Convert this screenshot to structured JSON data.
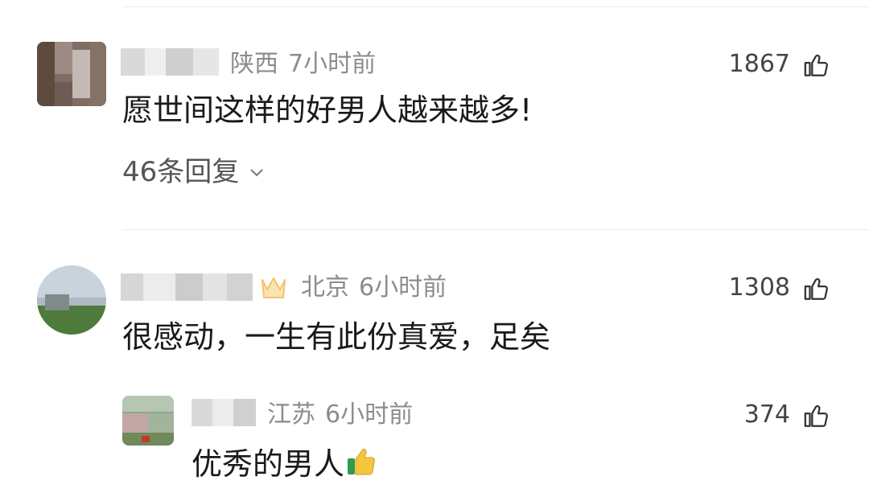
{
  "comments": [
    {
      "location": "陕西",
      "time": "7小时前",
      "likes": "1867",
      "text": "愿世间这样的好男人越来越多!",
      "replies_label": "46条回复"
    },
    {
      "location": "北京",
      "time": "6小时前",
      "likes": "1308",
      "text": "很感动，一生有此份真爱，足矣",
      "reply": {
        "location": "江苏",
        "time": "6小时前",
        "likes": "374",
        "text": "优秀的男人",
        "emoji": "thumbs-up-emoji"
      }
    }
  ],
  "icons": {
    "like": "thumb-up-icon",
    "expand": "chevron-down-icon",
    "badge": "crown-badge-icon"
  },
  "colors": {
    "meta_text": "#8c8c8c",
    "badge": "#f5c26b",
    "emoji_yellow": "#f6c53b",
    "emoji_green": "#2e9b4e"
  }
}
